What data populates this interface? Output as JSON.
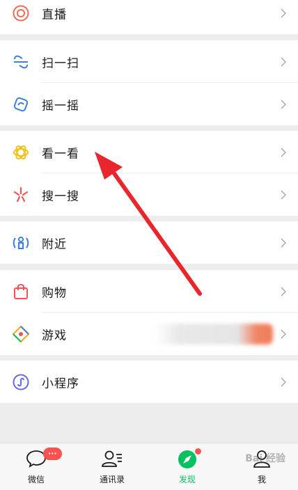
{
  "menu": {
    "live": "直播",
    "scan": "扫一扫",
    "shake": "摇一摇",
    "top_stories": "看一看",
    "search": "搜一搜",
    "nearby": "附近",
    "shopping": "购物",
    "games": "游戏",
    "mini_programs": "小程序"
  },
  "tabbar": {
    "chats": "微信",
    "chats_badge": "···",
    "contacts": "通讯录",
    "discover": "发现",
    "me": "我"
  },
  "watermark": "Bai 经验",
  "colors": {
    "accent_green": "#07c160",
    "badge_red": "#fa5151",
    "arrow_red": "#e8262b",
    "background": "#ededed"
  }
}
